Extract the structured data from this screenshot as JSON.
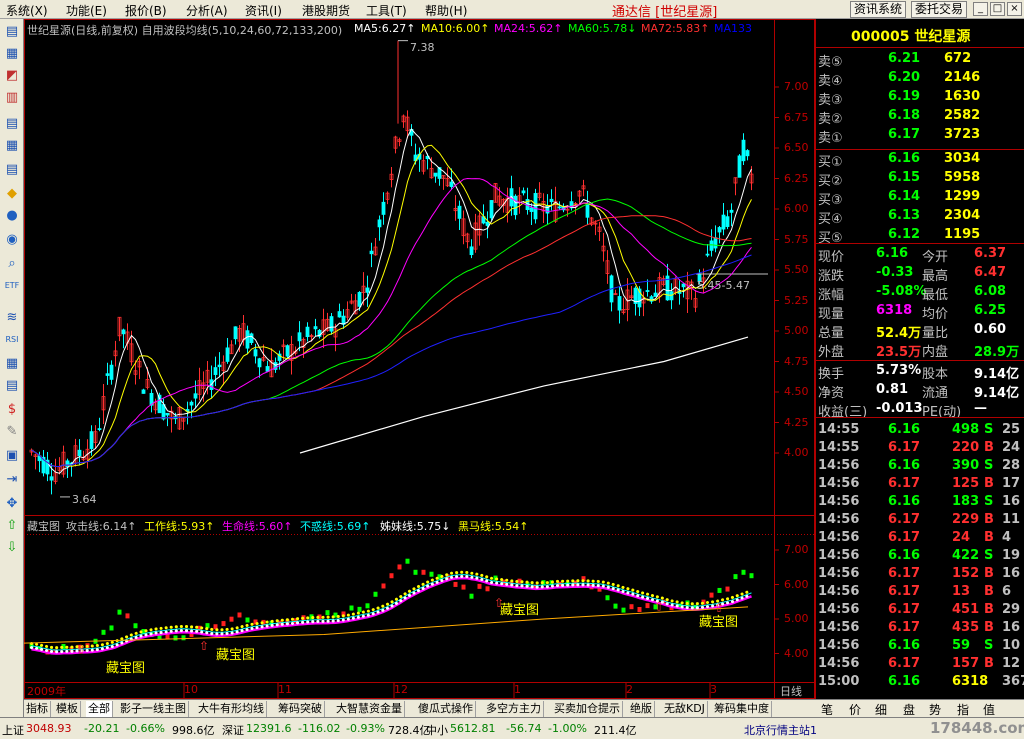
{
  "menu": {
    "items": [
      "系统(X)",
      "功能(E)",
      "报价(B)",
      "分析(A)",
      "资讯(I)",
      "港股期货",
      "工具(T)",
      "帮助(H)"
    ],
    "app_title": "通达信 [世纪星源]",
    "buttons": [
      "资讯系统",
      "委托交易"
    ],
    "window_controls": [
      "_",
      "□",
      "×"
    ]
  },
  "chart": {
    "title": "世纪星源(日线,前复权) 自用波段均线(5,10,24,60,72,133,200)",
    "ma_legend": [
      {
        "label": "MA5:6.27↑",
        "color": "#ffffff"
      },
      {
        "label": "MA10:6.00↑",
        "color": "#ffff00"
      },
      {
        "label": "MA24:5.62↑",
        "color": "#ff00ff"
      },
      {
        "label": "MA60:5.78↓",
        "color": "#00ff00"
      },
      {
        "label": "MA72:5.83↑",
        "color": "#ff3030"
      },
      {
        "label": "MA133",
        "color": "#0000ff"
      }
    ],
    "high_label": "7.38",
    "low_label": "3.64",
    "range_label": "5.45-5.47",
    "price_axis": [
      "7.00",
      "6.75",
      "6.50",
      "6.25",
      "6.00",
      "5.75",
      "5.50",
      "5.25",
      "5.00",
      "4.75",
      "4.50",
      "4.25",
      "4.00"
    ],
    "sub_title": "藏宝图",
    "sub_legend": [
      {
        "label": "攻击线:6.14↑",
        "color": "#c0c0c0"
      },
      {
        "label": "工作线:5.93↑",
        "color": "#ffff00"
      },
      {
        "label": "生命线:5.60↑",
        "color": "#ff00ff"
      },
      {
        "label": "不惑线:5.69↑",
        "color": "#00ffff"
      },
      {
        "label": "姊妹线:5.75↓",
        "color": "#ffffff"
      },
      {
        "label": "黑马线:5.54↑",
        "color": "#ffff00"
      }
    ],
    "sub_axis": [
      "7.00",
      "6.00",
      "5.00",
      "4.00"
    ],
    "treasure_labels": [
      "藏宝图",
      "藏宝图",
      "藏宝图",
      "藏宝图"
    ],
    "date_axis": [
      "2009年",
      "10",
      "11",
      "12",
      "1",
      "2",
      "3"
    ],
    "period": "日线"
  },
  "tabs": [
    "指标",
    "模板",
    "全部",
    "影子一线主图",
    "大牛有形均线",
    "筹码突破",
    "大智慧资金量",
    "傻瓜式操作",
    "多空方主力",
    "买卖加仓提示",
    "绝版",
    "无敌KDJ",
    "筹码集中度"
  ],
  "quote": {
    "code": "000005 世纪星源",
    "sell": [
      {
        "label": "卖⑤",
        "price": "6.21",
        "vol": "672"
      },
      {
        "label": "卖④",
        "price": "6.20",
        "vol": "2146"
      },
      {
        "label": "卖③",
        "price": "6.19",
        "vol": "1630"
      },
      {
        "label": "卖②",
        "price": "6.18",
        "vol": "2582"
      },
      {
        "label": "卖①",
        "price": "6.17",
        "vol": "3723"
      }
    ],
    "buy": [
      {
        "label": "买①",
        "price": "6.16",
        "vol": "3034"
      },
      {
        "label": "买②",
        "price": "6.15",
        "vol": "5958"
      },
      {
        "label": "买③",
        "price": "6.14",
        "vol": "1299"
      },
      {
        "label": "买④",
        "price": "6.13",
        "vol": "2304"
      },
      {
        "label": "买⑤",
        "price": "6.12",
        "vol": "1195"
      }
    ],
    "stats": [
      {
        "l1": "现价",
        "v1": "6.16",
        "c1": "#00ff00",
        "l2": "今开",
        "v2": "6.37",
        "c2": "#ff3030"
      },
      {
        "l1": "涨跌",
        "v1": "-0.33",
        "c1": "#00ff00",
        "l2": "最高",
        "v2": "6.47",
        "c2": "#ff3030"
      },
      {
        "l1": "涨幅",
        "v1": "-5.08%",
        "c1": "#00ff00",
        "l2": "最低",
        "v2": "6.08",
        "c2": "#00ff00"
      },
      {
        "l1": "现量",
        "v1": "6318",
        "c1": "#ff00ff",
        "l2": "均价",
        "v2": "6.25",
        "c2": "#00ff00"
      },
      {
        "l1": "总量",
        "v1": "52.4万",
        "c1": "#ffff00",
        "l2": "量比",
        "v2": "0.60",
        "c2": "#ffffff"
      },
      {
        "l1": "外盘",
        "v1": "23.5万",
        "c1": "#ff3030",
        "l2": "内盘",
        "v2": "28.9万",
        "c2": "#00ff00"
      },
      {
        "l1": "换手",
        "v1": "5.73%",
        "c1": "#ffffff",
        "l2": "股本",
        "v2": "9.14亿",
        "c2": "#ffffff"
      },
      {
        "l1": "净资",
        "v1": "0.81",
        "c1": "#ffffff",
        "l2": "流通",
        "v2": "9.14亿",
        "c2": "#ffffff"
      },
      {
        "l1": "收益(三)",
        "v1": "-0.013",
        "c1": "#ffffff",
        "l2": "PE(动)",
        "v2": "—",
        "c2": "#ffffff"
      }
    ],
    "ticks": [
      {
        "t": "14:55",
        "p": "6.16",
        "v": "498",
        "s": "S",
        "n": "25"
      },
      {
        "t": "14:55",
        "p": "6.17",
        "v": "220",
        "s": "B",
        "n": "24"
      },
      {
        "t": "14:56",
        "p": "6.16",
        "v": "390",
        "s": "S",
        "n": "28"
      },
      {
        "t": "14:56",
        "p": "6.17",
        "v": "125",
        "s": "B",
        "n": "17"
      },
      {
        "t": "14:56",
        "p": "6.16",
        "v": "183",
        "s": "S",
        "n": "16"
      },
      {
        "t": "14:56",
        "p": "6.17",
        "v": "229",
        "s": "B",
        "n": "11"
      },
      {
        "t": "14:56",
        "p": "6.17",
        "v": "24",
        "s": "B",
        "n": "4"
      },
      {
        "t": "14:56",
        "p": "6.16",
        "v": "422",
        "s": "S",
        "n": "19"
      },
      {
        "t": "14:56",
        "p": "6.17",
        "v": "152",
        "s": "B",
        "n": "16"
      },
      {
        "t": "14:56",
        "p": "6.17",
        "v": "13",
        "s": "B",
        "n": "6"
      },
      {
        "t": "14:56",
        "p": "6.17",
        "v": "451",
        "s": "B",
        "n": "29"
      },
      {
        "t": "14:56",
        "p": "6.17",
        "v": "435",
        "s": "B",
        "n": "16"
      },
      {
        "t": "14:56",
        "p": "6.16",
        "v": "59",
        "s": "S",
        "n": "10"
      },
      {
        "t": "14:56",
        "p": "6.17",
        "v": "157",
        "s": "B",
        "n": "12"
      },
      {
        "t": "15:00",
        "p": "6.16",
        "v": "6318",
        "s": "",
        "n": "367"
      }
    ],
    "tabs": [
      "笔",
      "价",
      "细",
      "盘",
      "势",
      "指",
      "值"
    ]
  },
  "status": {
    "sh_label": "上证",
    "sh_val": "3048.93",
    "sh_chg": "-20.21",
    "sh_pct": "-0.66%",
    "sh_amt": "998.6亿",
    "sz_label": "深证",
    "sz_val": "12391.6",
    "sz_chg": "-116.02",
    "sz_pct": "-0.93%",
    "sz_amt": "728.4亿",
    "zx_label": "中小",
    "zx_val": "5612.81",
    "zx_chg": "-56.74",
    "zx_pct": "-1.00%",
    "zx_amt": "211.4亿",
    "server": "北京行情主站1",
    "watermark": "178448.com"
  },
  "colors": {
    "up": "#ff3030",
    "down": "#00ffff",
    "border": "#b00000"
  }
}
